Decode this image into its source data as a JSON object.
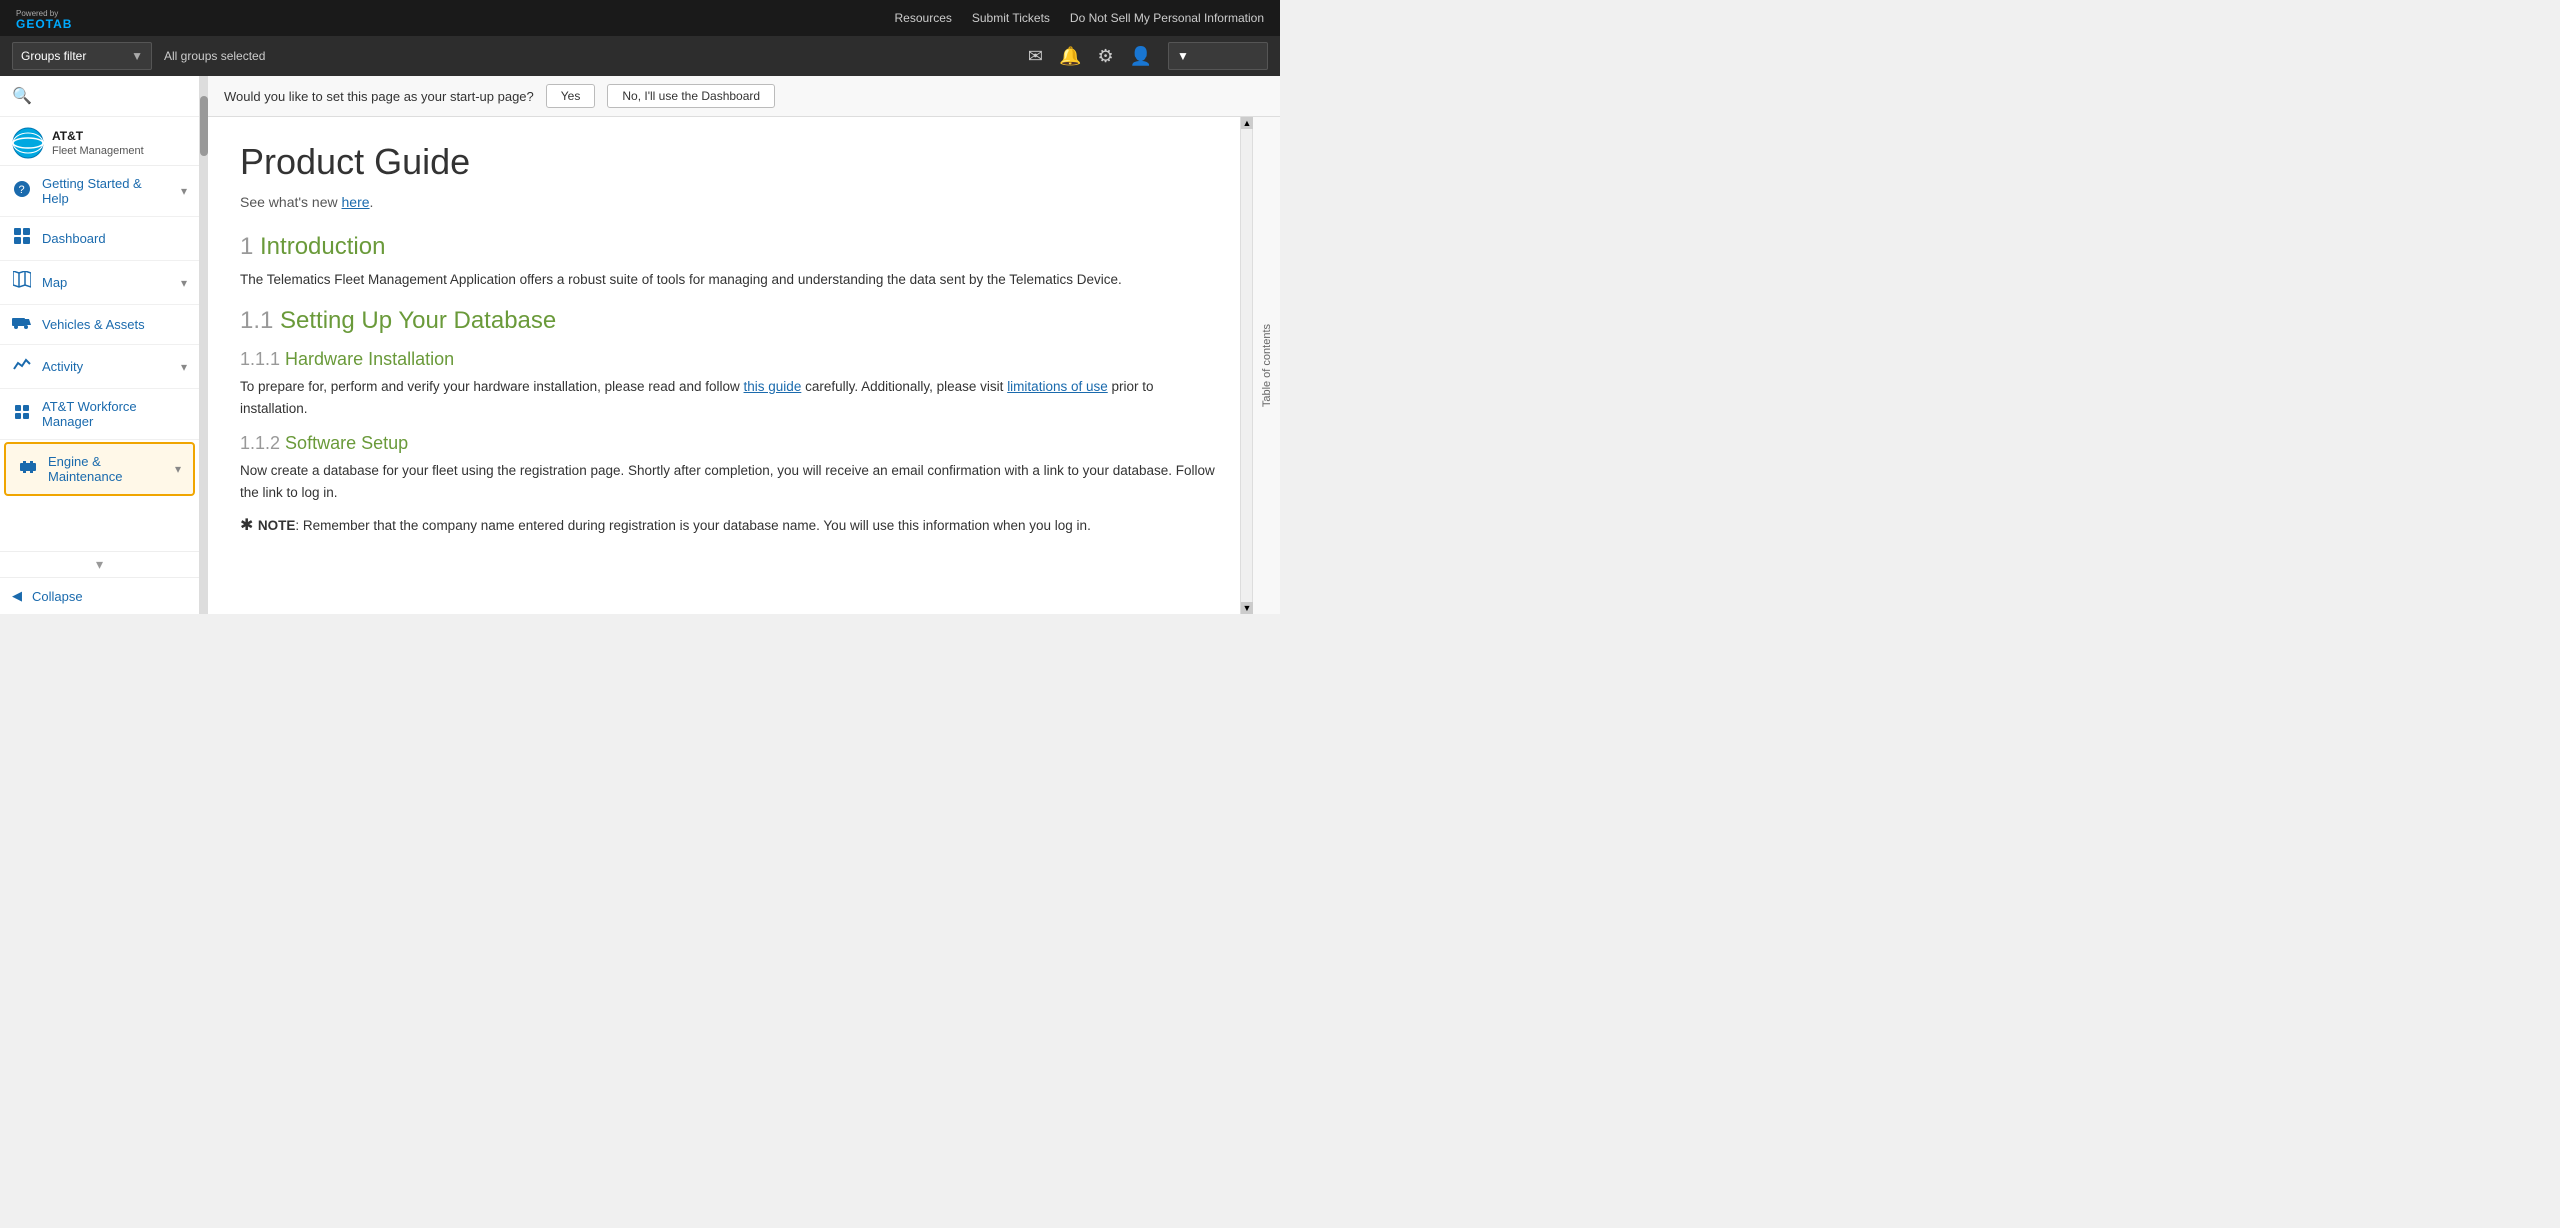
{
  "topbar": {
    "powered_by": "Powered by",
    "logo_text": "GEOTAB",
    "nav_links": {
      "resources": "Resources",
      "submit_tickets": "Submit Tickets",
      "do_not_sell": "Do Not Sell My Personal Information"
    }
  },
  "groupsbar": {
    "filter_label": "Groups filter",
    "filter_value": "All groups selected"
  },
  "sidebar": {
    "brand_name": "AT&T",
    "brand_sub": "Fleet Management",
    "items": [
      {
        "id": "getting-started",
        "label": "Getting Started & Help",
        "has_chevron": true,
        "icon": "?"
      },
      {
        "id": "dashboard",
        "label": "Dashboard",
        "has_chevron": false,
        "icon": "📊"
      },
      {
        "id": "map",
        "label": "Map",
        "has_chevron": true,
        "icon": "🗺"
      },
      {
        "id": "vehicles",
        "label": "Vehicles & Assets",
        "has_chevron": false,
        "icon": "🚛"
      },
      {
        "id": "activity",
        "label": "Activity",
        "has_chevron": true,
        "icon": "📈"
      },
      {
        "id": "workforce",
        "label": "AT&T Workforce Manager",
        "has_chevron": false,
        "icon": "🧩"
      },
      {
        "id": "engine",
        "label": "Engine & Maintenance",
        "has_chevron": true,
        "icon": "🎬",
        "active": true
      }
    ],
    "collapse_label": "Collapse"
  },
  "startup_bar": {
    "question": "Would you like to set this page as your start-up page?",
    "yes_label": "Yes",
    "no_label": "No, I'll use the Dashboard"
  },
  "content": {
    "toc_label": "Table of contents",
    "title": "Product Guide",
    "subtitle_text": "See what's new ",
    "subtitle_link": "here",
    "subtitle_end": ".",
    "sections": [
      {
        "number": "1",
        "title": "Introduction",
        "body": "The Telematics Fleet Management Application offers a robust suite of tools for managing and understanding the data sent by the Telematics Device.",
        "subsections": [
          {
            "number": "1.1",
            "title": "Setting Up Your Database",
            "subsubsections": [
              {
                "number": "1.1.1",
                "title": "Hardware Installation",
                "body_pre": "To prepare for, perform and verify your hardware installation, please read and follow ",
                "body_link1": "this guide",
                "body_mid": " carefully. Additionally, please visit ",
                "body_link2": "limitations of use",
                "body_end": " prior to installation."
              },
              {
                "number": "1.1.2",
                "title": "Software Setup",
                "body": "Now create a database for your fleet using the registration page. Shortly after completion, you will receive an email confirmation with a link to your database. Follow the link to log in."
              }
            ]
          }
        ]
      }
    ],
    "note": "NOTE: Remember that the company name entered during registration is your database name. You will use this information when you log in."
  }
}
